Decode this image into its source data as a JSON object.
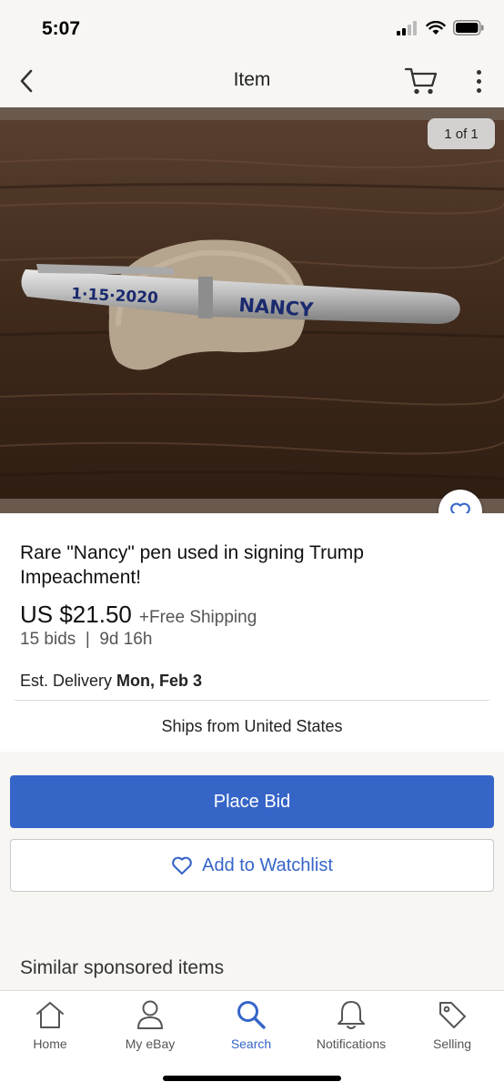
{
  "status": {
    "time": "5:07"
  },
  "nav": {
    "title": "Item"
  },
  "gallery": {
    "counter": "1 of 1",
    "pen_text_1": "1·15·2020",
    "pen_text_2": "NANCY"
  },
  "item": {
    "title": "Rare \"Nancy\" pen used in signing Trump Impeachment!",
    "price": "US $21.50",
    "shipping": "+Free Shipping",
    "bids": "15 bids  |  9d 16h",
    "delivery_label": "Est. Delivery",
    "delivery_date": "Mon, Feb 3",
    "ships_from": "Ships from United States"
  },
  "actions": {
    "place_bid": "Place Bid",
    "add_watchlist": "Add to Watchlist"
  },
  "similar": {
    "heading": "Similar sponsored items"
  },
  "tabs": [
    {
      "label": "Home",
      "icon": "home-icon"
    },
    {
      "label": "My eBay",
      "icon": "person-icon"
    },
    {
      "label": "Search",
      "icon": "search-icon",
      "active": true
    },
    {
      "label": "Notifications",
      "icon": "bell-icon"
    },
    {
      "label": "Selling",
      "icon": "tag-icon"
    }
  ],
  "colors": {
    "accent": "#3665c8",
    "background": "#f7f6f3"
  }
}
